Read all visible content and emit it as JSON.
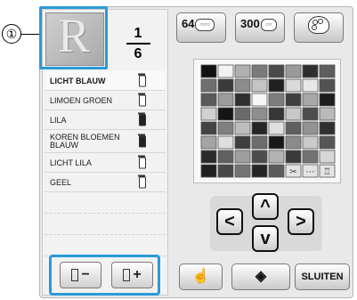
{
  "callout": {
    "number": "①"
  },
  "preview": {
    "letter": "R"
  },
  "page": {
    "current": "1",
    "total": "6"
  },
  "thread_list": [
    {
      "name": "LICHT BLAUW",
      "spool": "outline",
      "selected": true
    },
    {
      "name": "LIMOEN GROEN",
      "spool": "outline"
    },
    {
      "name": "LILA",
      "spool": "filled"
    },
    {
      "name": "KOREN BLOEMEN BLAUW",
      "spool": "filled"
    },
    {
      "name": "LICHT LILA",
      "spool": "outline"
    },
    {
      "name": "GEEL",
      "spool": "outline"
    }
  ],
  "spool_buttons": {
    "minus_label": "−",
    "plus_label": "+"
  },
  "top_buttons": {
    "btn64_label": "64",
    "btn300_label": "300",
    "palette_icon": "palette-icon"
  },
  "color_grid": {
    "rows": [
      [
        "#111111",
        "#f2f2f2",
        "#b0b0b0",
        "#7a7a7a",
        "#4a4a4a",
        "#9a9a9a",
        "#2e2e2e",
        "#5e5e5e"
      ],
      [
        "#6f6f6f",
        "#3b3b3b",
        "#8c8c8c",
        "#c4c4c4",
        "#202020",
        "#dadada",
        "#e8e8e8",
        "#525252"
      ],
      [
        "#5a5a5a",
        "#9c9c9c",
        "#2f2f2f",
        "#f6f6f6",
        "#7d7d7d",
        "#404040",
        "#a8a8a8",
        "#1c1c1c"
      ],
      [
        "#d0d0d0",
        "#151515",
        "#6a6a6a",
        "#8e8e8e",
        "#363636",
        "#c8c8c8",
        "#4e4e4e",
        "#b9b9b9"
      ],
      [
        "#444444",
        "#7f7f7f",
        "#bdbdbd",
        "#252525",
        "#e0e0e0",
        "#5f5f5f",
        "#929292",
        "#303030"
      ],
      [
        "#a4a4a4",
        "#dedede",
        "#3e3e3e",
        "#6c6c6c",
        "#181818",
        "#8a8a8a",
        "#cacaca",
        "#565656"
      ],
      [
        "#2a2a2a",
        "#606060",
        "#9e9e9e",
        "#4c4c4c",
        "#b3b3b3",
        "#3a3a3a",
        "#727272",
        "#d6d6d6"
      ],
      [
        "#1f1f1f",
        "#484848",
        "#747474",
        "#262626",
        "#5c5c5c",
        "#e4e4e4",
        "#e4e4e4",
        "#e4e4e4"
      ]
    ],
    "special_cells": [
      "scissors-icon",
      "dashes-icon",
      "tie-icon"
    ]
  },
  "arrows": {
    "up": "^",
    "down": "v",
    "left": "<",
    "right": ">"
  },
  "bottom_buttons": {
    "close_label": "SLUITEN",
    "hand_icon": "hand-icon",
    "diamond_icon": "diamond-icon"
  }
}
